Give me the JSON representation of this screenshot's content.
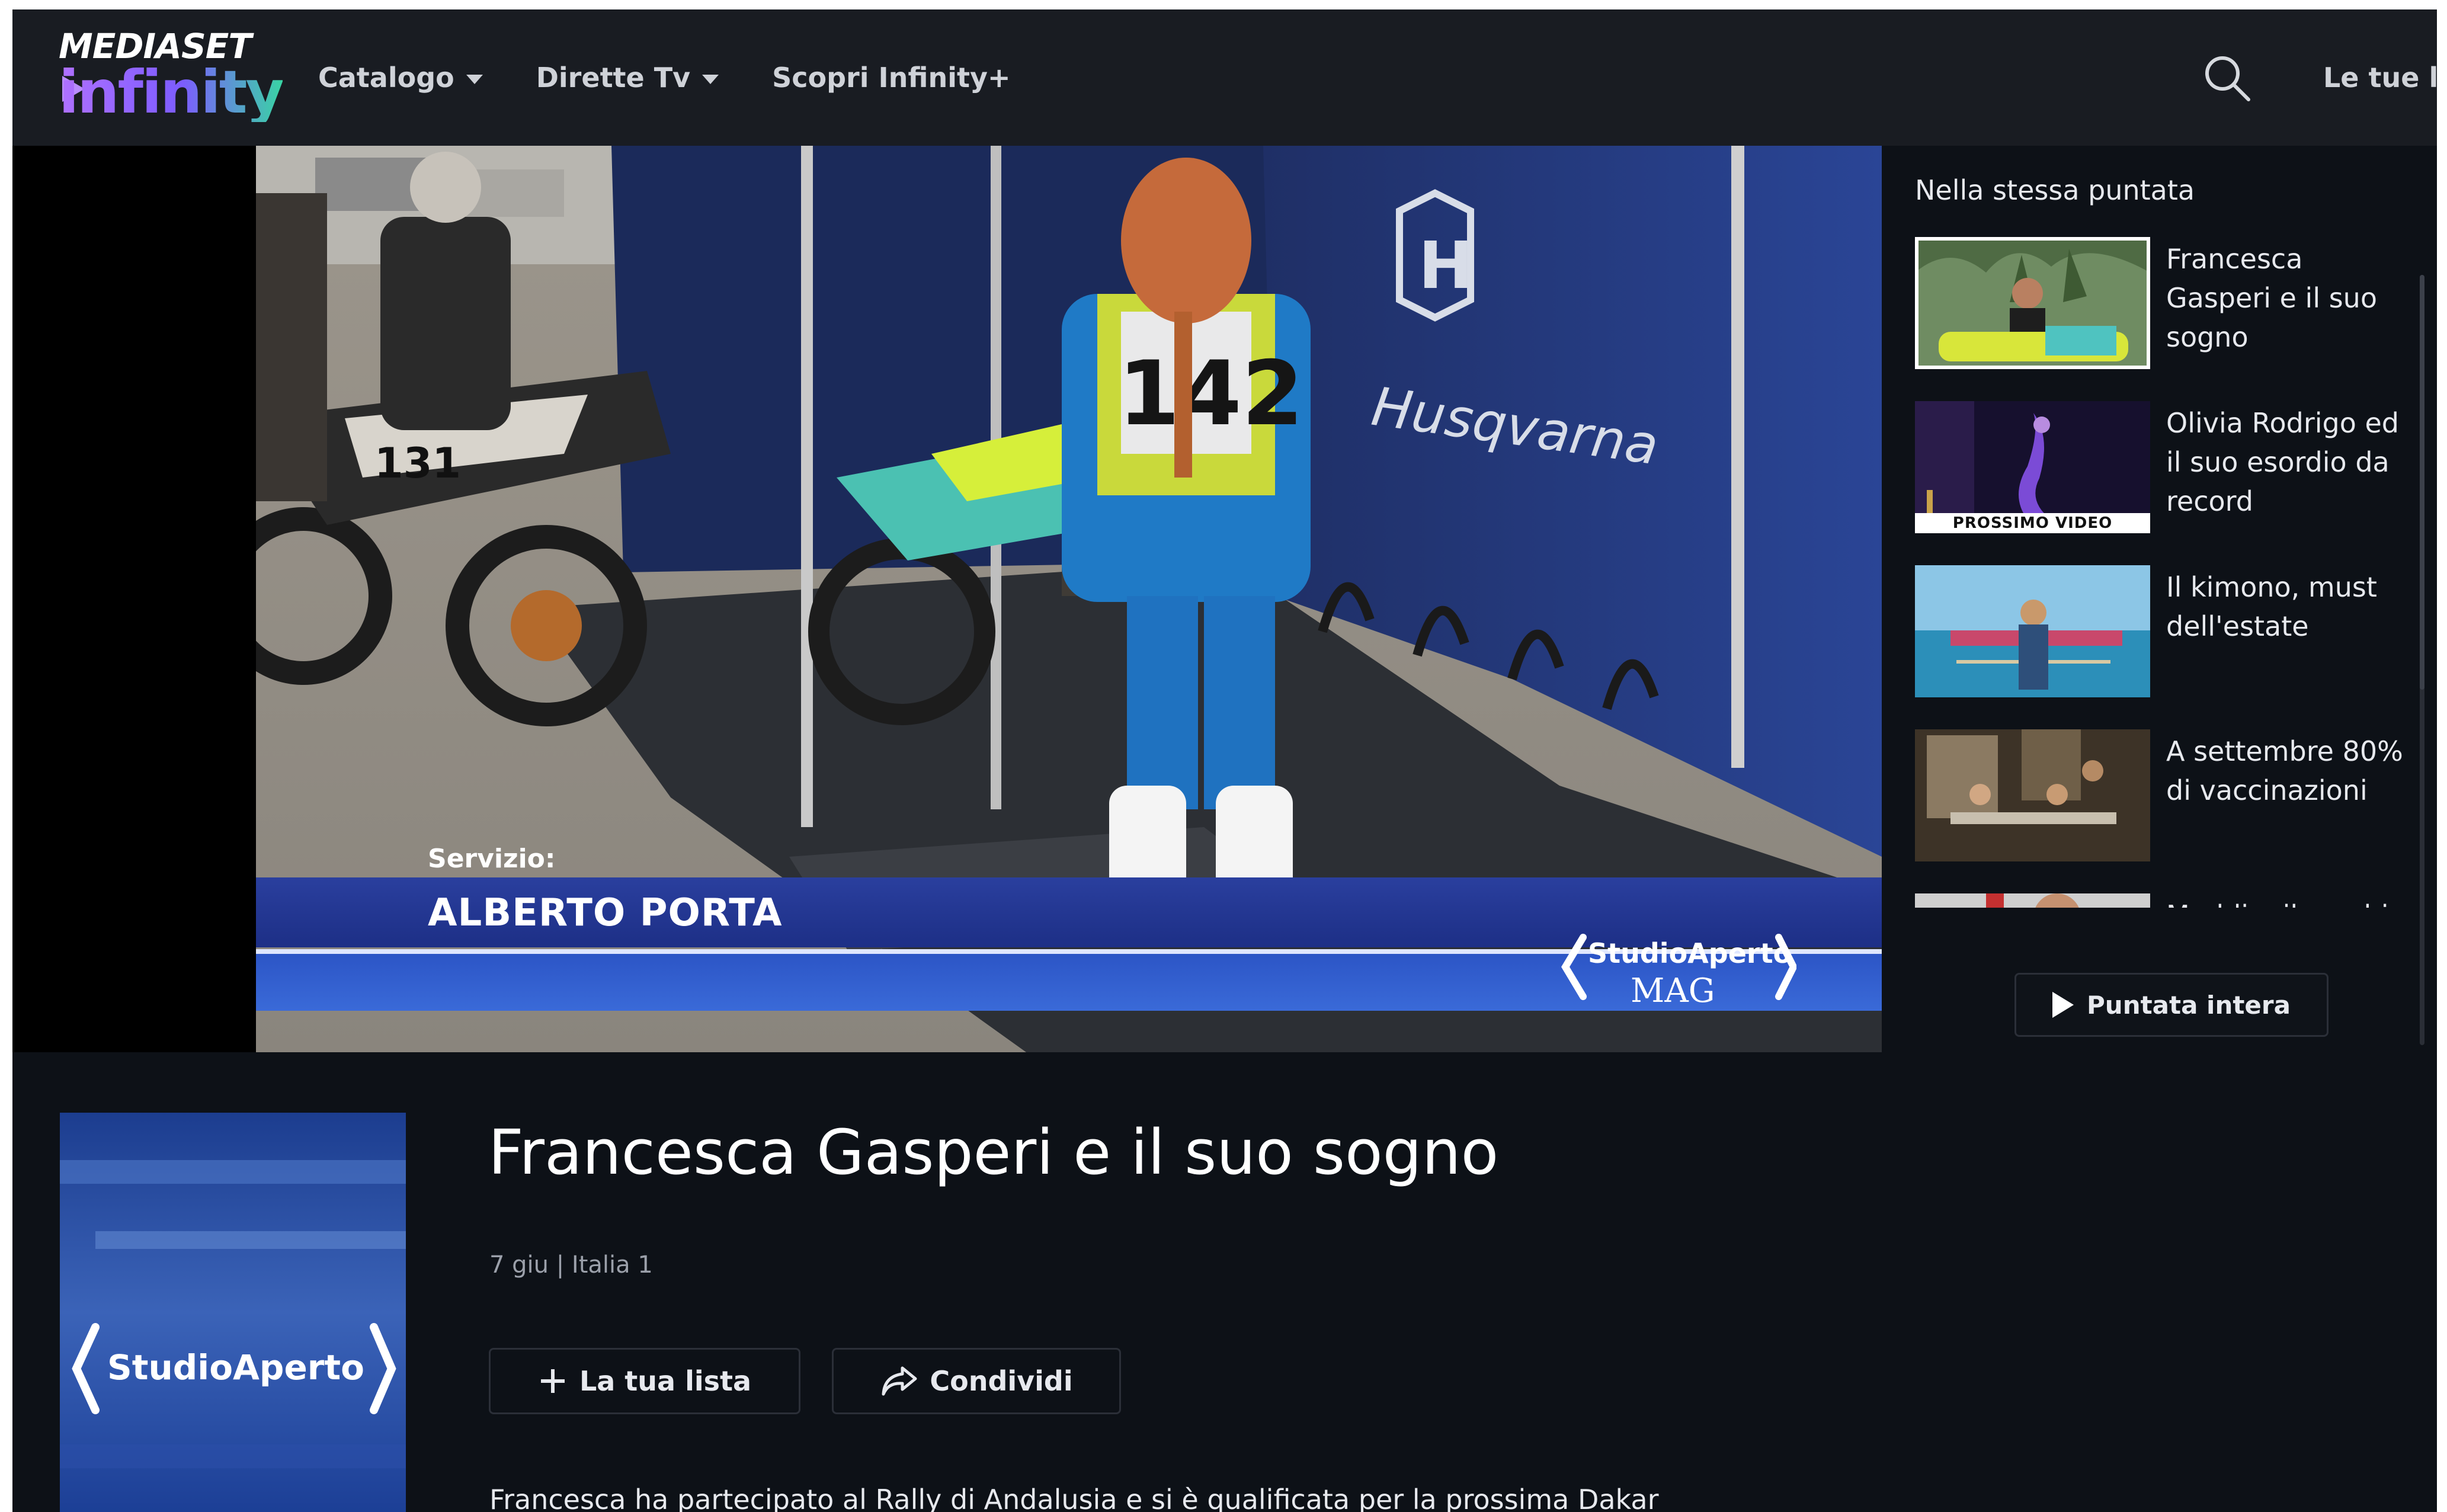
{
  "header": {
    "logo_top": "MEDIASET",
    "logo_bottom": "infinity",
    "nav": [
      {
        "label": "Catalogo",
        "has_dropdown": true
      },
      {
        "label": "Dirette Tv",
        "has_dropdown": true
      },
      {
        "label": "Scopri Infinity+",
        "has_dropdown": false
      }
    ],
    "search_icon": "search-icon",
    "lists_label": "Le tue li"
  },
  "player": {
    "servizio_label": "Servizio:",
    "reporter": "ALBERTO PORTA",
    "bib_number": "142",
    "bike_number": "131",
    "tent_brand": "Husqvarna",
    "program_logo": "StudioAperto",
    "program_logo_suffix": "MAG"
  },
  "sidebar": {
    "title": "Nella stessa puntata",
    "items": [
      {
        "title": "Francesca Gasperi e il suo sogno",
        "active": true,
        "badge": ""
      },
      {
        "title": "Olivia Rodrigo ed il suo esordio da record",
        "active": false,
        "badge": "PROSSIMO VIDEO"
      },
      {
        "title": "Il kimono, must dell'estate",
        "active": false,
        "badge": ""
      },
      {
        "title": "A settembre 80% di vaccinazioni",
        "active": false,
        "badge": ""
      },
      {
        "title": "Maddie, il cerchio",
        "active": false,
        "badge": ""
      }
    ],
    "full_episode_label": "Puntata intera"
  },
  "episode": {
    "poster_logo": "StudioAperto",
    "title": "Francesca Gasperi e il suo sogno",
    "meta": "7 giu | Italia 1",
    "add_list_label": "La tua lista",
    "share_label": "Condividi",
    "description": "Francesca ha partecipato al Rally di Andalusia e si è qualificata per la prossima Dakar"
  },
  "colors": {
    "background": "#0d1117",
    "header": "#191c22",
    "accent_purple": "#b071ff",
    "accent_green": "#39d4a4",
    "lower_third_blue": "#2a3f9e"
  }
}
